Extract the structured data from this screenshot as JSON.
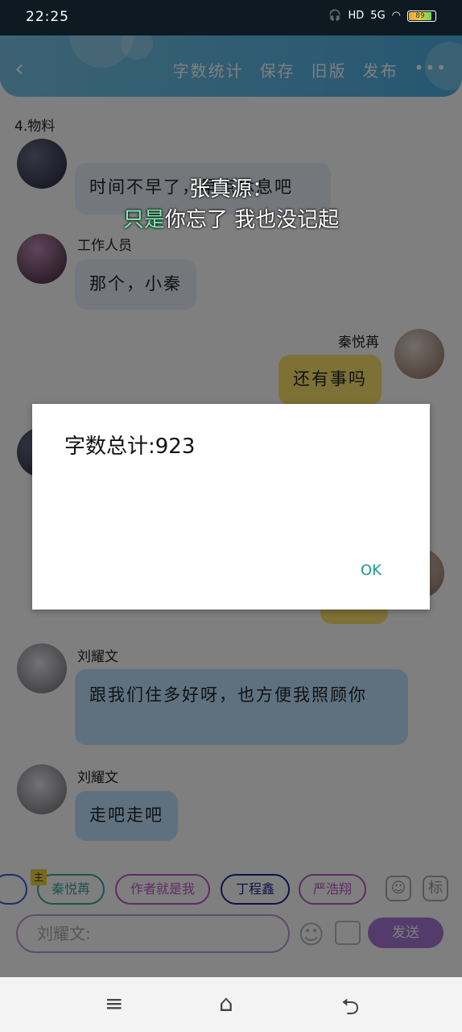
{
  "status": {
    "time": "22:25",
    "icons": [
      "headphones-icon",
      "hd-icon",
      "5g-signal-icon",
      "wifi-icon"
    ],
    "network": "5G",
    "hd": "HD",
    "battery": "89"
  },
  "appbar": {
    "actions": [
      "字数统计",
      "保存",
      "旧版",
      "发布"
    ],
    "more": "•••"
  },
  "chapter_title": "4.物料",
  "messages": [
    {
      "sender": "",
      "text": "时间不早了，早点休息吧",
      "side": "left"
    },
    {
      "sender": "工作人员",
      "text": "那个，小秦",
      "side": "left"
    },
    {
      "sender": "秦悦苒",
      "text": "还有事吗",
      "side": "right"
    },
    {
      "sender": "刘耀文",
      "text": "跟我们住多好呀，也方便我照顾你",
      "side": "left"
    },
    {
      "sender": "刘耀文",
      "text": "走吧走吧",
      "side": "left"
    }
  ],
  "caption": {
    "line1": "张真源：",
    "line2_hl": "只是",
    "line2_rest": "你忘了 我也没记起"
  },
  "dialog": {
    "message": "字数总计:923",
    "ok": "OK"
  },
  "composer": {
    "chips": [
      {
        "label": "秦悦苒",
        "badge": "主",
        "color": "#3ba89a"
      },
      {
        "label": "作者就是我",
        "color": "#c058c8"
      },
      {
        "label": "丁程鑫",
        "color": "#1a2a8a"
      },
      {
        "label": "严浩翔",
        "color": "#c058c8"
      }
    ],
    "role_icon": "person-icon",
    "tag_label": "标",
    "input_placeholder": "刘耀文:",
    "send": "发送"
  },
  "nav": {
    "menu": "≡",
    "home": "⌂",
    "back": "⮌"
  }
}
